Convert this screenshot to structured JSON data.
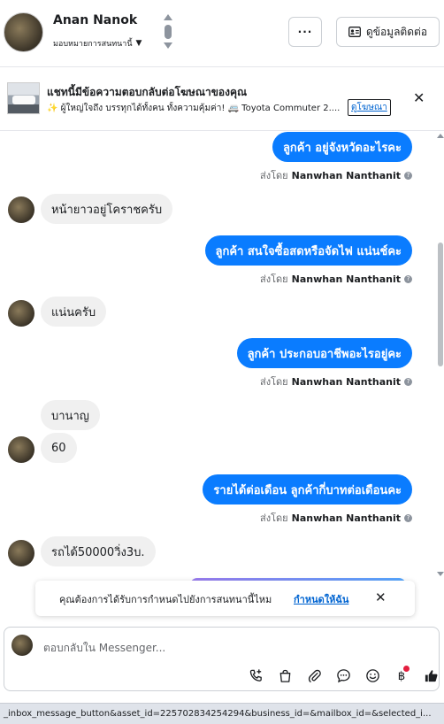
{
  "header": {
    "contact_name": "Anan Nanok",
    "assign_label": "มอบหมายการสนทนานี้",
    "more_label": "···",
    "contact_info_label": "ดูข้อมูลติดต่อ"
  },
  "ad_banner": {
    "title": "แชทนี้มีข้อความตอบกลับต่อโฆษณาของคุณ",
    "description": "✨ ผู้ใหญ่ใจถึง บรรทุกได้ทั้งคน ทั้งความคุ้มค่า! 🚐 Toyota Commuter 2....",
    "link_label": "ดูโฆษณา",
    "close_label": "✕"
  },
  "messages": [
    {
      "dir": "out",
      "text": "ลูกค้า อยู่จังหวัดอะไรคะ"
    },
    {
      "dir": "out_meta",
      "prefix": "ส่งโดย",
      "sender": "Nanwhan Nanthanit"
    },
    {
      "dir": "in",
      "text": "หน้ายาวอยู่โคราชครับ"
    },
    {
      "dir": "out",
      "text": "ลูกค้า สนใจซื้อสดหรือจัดไฟ แน่นช์คะ"
    },
    {
      "dir": "out_meta",
      "prefix": "ส่งโดย",
      "sender": "Nanwhan Nanthanit"
    },
    {
      "dir": "in",
      "text": "แน่นครับ"
    },
    {
      "dir": "out",
      "text": "ลูกค้า ประกอบอาชีพอะไรอยู่คะ"
    },
    {
      "dir": "out_meta",
      "prefix": "ส่งโดย",
      "sender": "Nanwhan Nanthanit"
    },
    {
      "dir": "in",
      "text": "บานาญ"
    },
    {
      "dir": "in",
      "text": "60"
    },
    {
      "dir": "out",
      "text": "รายได้ต่อเดือน  ลูกค้ากี่บาทต่อเดือนคะ"
    },
    {
      "dir": "out_meta",
      "prefix": "ส่งโดย",
      "sender": "Nanwhan Nanthanit"
    },
    {
      "dir": "in",
      "text": "รถได้50000วิ่ง3บ."
    }
  ],
  "assign_toast": {
    "message": "คุณต้องการได้รับการกำหนดไปยังการสนทนานี้ไหม",
    "action": "กำหนดให้ฉัน",
    "close": "✕"
  },
  "composer": {
    "placeholder": "ตอบกลับใน Messenger..."
  },
  "toolbar_icons": [
    "call-add-icon",
    "bag-icon",
    "attachment-icon",
    "saved-reply-icon",
    "emoji-icon",
    "baht-icon",
    "thumbs-up-icon"
  ],
  "status_url": "_inbox_message_button&asset_id=225702834254294&business_id=&mailbox_id=&selected_i..."
}
